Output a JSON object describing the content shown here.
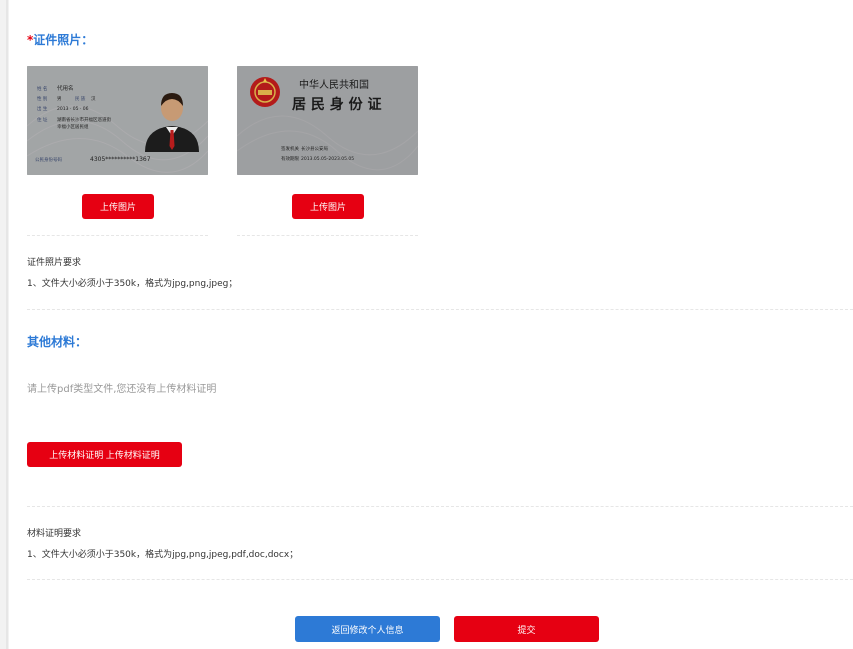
{
  "id_photos": {
    "title": "证件照片：",
    "required_mark": "*",
    "front_card": {
      "name_label": "姓 名",
      "name_value": "代用名",
      "gender_label": "性 别",
      "gender_value": "男",
      "nation_label": "民 族",
      "nation_value": "汉",
      "birth_label": "出 生",
      "birth_value": "2013 · 05 · 06",
      "address_label": "住 址",
      "address_line1": "湖南省长沙市开福区巡道街",
      "address_line2": "幸福小区居民组",
      "id_label": "公民身份号码",
      "id_value": "4305**********1367"
    },
    "back_card": {
      "country": "中华人民共和国",
      "title": "居 民 身 份 证",
      "authority_label": "签发机关",
      "authority_value": "长沙县公安局",
      "validity_label": "有效期限",
      "validity_value": "2013.05.05-2023.05.05"
    },
    "upload_front_label": "上传图片",
    "upload_back_label": "上传图片",
    "requirement_title": "证件照片要求",
    "requirement_text": "1、文件大小必须小于350k，格式为jpg,png,jpeg；"
  },
  "other_materials": {
    "title": "其他材料：",
    "hint": "请上传pdf类型文件,您还没有上传材料证明",
    "upload_label": "上传材料证明 上传材料证明",
    "requirement_title": "材料证明要求",
    "requirement_text": "1、文件大小必须小于350k，格式为jpg,png,jpeg,pdf,doc,docx；"
  },
  "actions": {
    "back_label": "返回修改个人信息",
    "submit_label": "提交"
  },
  "colors": {
    "accent_blue": "#2d7ad6",
    "accent_red": "#e60012",
    "hint_gray": "#999999"
  }
}
